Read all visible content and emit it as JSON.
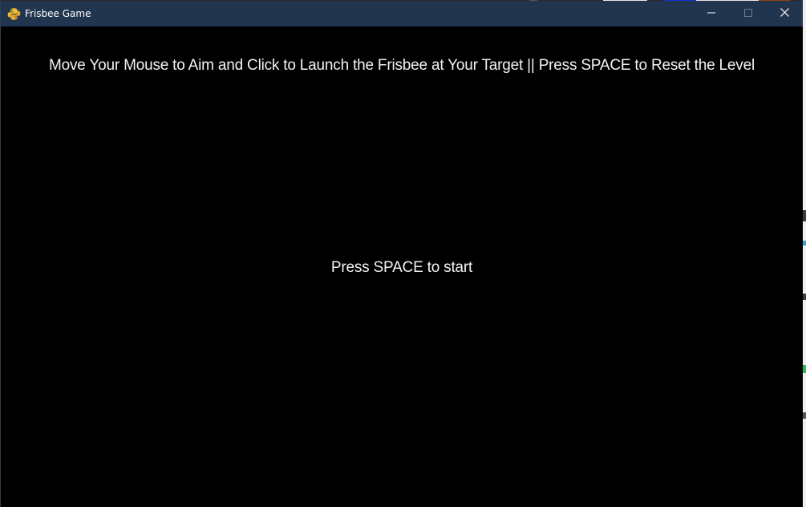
{
  "window": {
    "title": "Frisbee Game",
    "icon": "python-icon",
    "controls": {
      "minimize": "minimize-icon",
      "maximize": "maximize-icon",
      "close": "close-icon"
    }
  },
  "game": {
    "instructions": "Move Your Mouse to Aim and Click to Launch the Frisbee at Your Target || Press SPACE to Reset the Level",
    "start_prompt": "Press SPACE to start"
  },
  "colors": {
    "titlebar": "#22354f",
    "canvas": "#000000",
    "text": "#f2f2f2"
  }
}
